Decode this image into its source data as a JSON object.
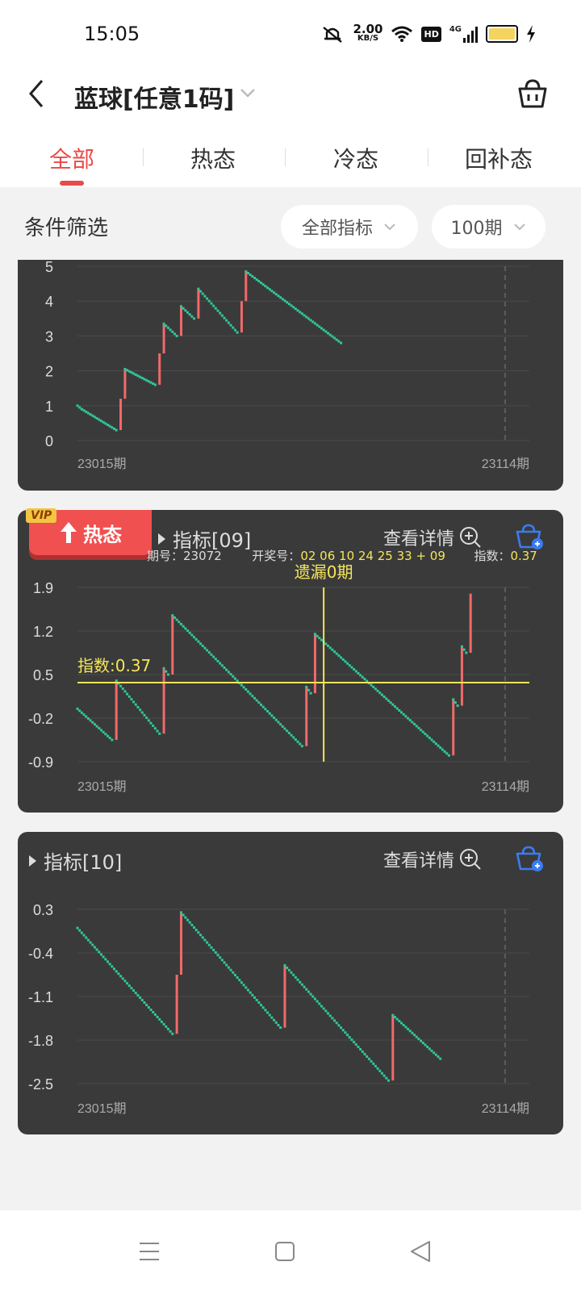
{
  "status_bar": {
    "time": "15:05",
    "network_speed_value": "2.00",
    "network_speed_unit": "KB/S",
    "hd_label": "HD",
    "signal_label": "4G"
  },
  "header": {
    "title": "蓝球[任意1码]"
  },
  "tabs": [
    {
      "label": "全部",
      "active": true
    },
    {
      "label": "热态",
      "active": false
    },
    {
      "label": "冷态",
      "active": false
    },
    {
      "label": "回补态",
      "active": false
    }
  ],
  "filter": {
    "label": "条件筛选",
    "indicator_select": "全部指标",
    "period_select": "100期"
  },
  "colors": {
    "accent": "#e84a4a",
    "card_bg": "#3a3a3a",
    "up_bar": "#f06a6a",
    "down_dot": "#2fc79a",
    "highlight": "#f5e55a"
  },
  "cards": [
    {
      "chart_data": {
        "type": "line",
        "y_ticks": [
          "5",
          "4",
          "3",
          "2",
          "1",
          "0"
        ],
        "ylim": [
          0,
          5
        ],
        "x_start_label": "23015期",
        "x_end_label": "23114期",
        "points": [
          [
            0,
            1.0
          ],
          [
            1,
            0.9
          ],
          [
            9,
            0.3
          ],
          [
            10,
            1.2
          ],
          [
            11,
            2.05
          ],
          [
            18,
            1.6
          ],
          [
            19,
            2.5
          ],
          [
            20,
            3.35
          ],
          [
            23,
            3.0
          ],
          [
            24,
            3.85
          ],
          [
            27,
            3.5
          ],
          [
            28,
            4.35
          ],
          [
            37,
            3.1
          ],
          [
            38,
            4.0
          ],
          [
            39,
            4.85
          ],
          [
            61,
            2.8
          ]
        ]
      }
    },
    {
      "vip": {
        "tag": "VIP",
        "label": "热态"
      },
      "indicator": "指标[09]",
      "detail": "查看详情",
      "info": {
        "period_label": "期号：",
        "period": "23072",
        "draw_label": "开奖号：",
        "draw_numbers": "02 06 10 24 25 33 + 09",
        "index_label": "指数：",
        "index_value": "0.37"
      },
      "cursor_label": "遗漏0期",
      "index_line_label": "指数:0.37",
      "chart_data": {
        "type": "line",
        "y_ticks": [
          "1.9",
          "1.2",
          "0.5",
          "-0.2",
          "-0.9"
        ],
        "ylim": [
          -0.9,
          1.9
        ],
        "x_start_label": "23015期",
        "x_end_label": "23114期",
        "index_value": 0.37,
        "cursor_index": 57,
        "points": [
          [
            0,
            -0.05
          ],
          [
            8,
            -0.55
          ],
          [
            9,
            0.4
          ],
          [
            19,
            -0.45
          ],
          [
            20,
            0.6
          ],
          [
            21,
            0.5
          ],
          [
            22,
            1.45
          ],
          [
            52,
            -0.65
          ],
          [
            53,
            0.3
          ],
          [
            54,
            0.2
          ],
          [
            55,
            1.15
          ],
          [
            86,
            -0.8
          ],
          [
            87,
            0.1
          ],
          [
            88,
            0.0
          ],
          [
            89,
            0.95
          ],
          [
            90,
            0.85
          ],
          [
            91,
            1.8
          ]
        ]
      }
    },
    {
      "indicator": "指标[10]",
      "detail": "查看详情",
      "chart_data": {
        "type": "line",
        "y_ticks": [
          "0.3",
          "-0.4",
          "-1.1",
          "-1.8",
          "-2.5"
        ],
        "ylim": [
          -2.5,
          0.3
        ],
        "x_start_label": "23015期",
        "x_end_label": "23114期",
        "points": [
          [
            0,
            0.0
          ],
          [
            22,
            -1.7
          ],
          [
            23,
            -0.75
          ],
          [
            24,
            0.25
          ],
          [
            47,
            -1.6
          ],
          [
            48,
            -0.6
          ],
          [
            72,
            -2.45
          ],
          [
            73,
            -1.4
          ],
          [
            84,
            -2.1
          ]
        ]
      }
    }
  ]
}
